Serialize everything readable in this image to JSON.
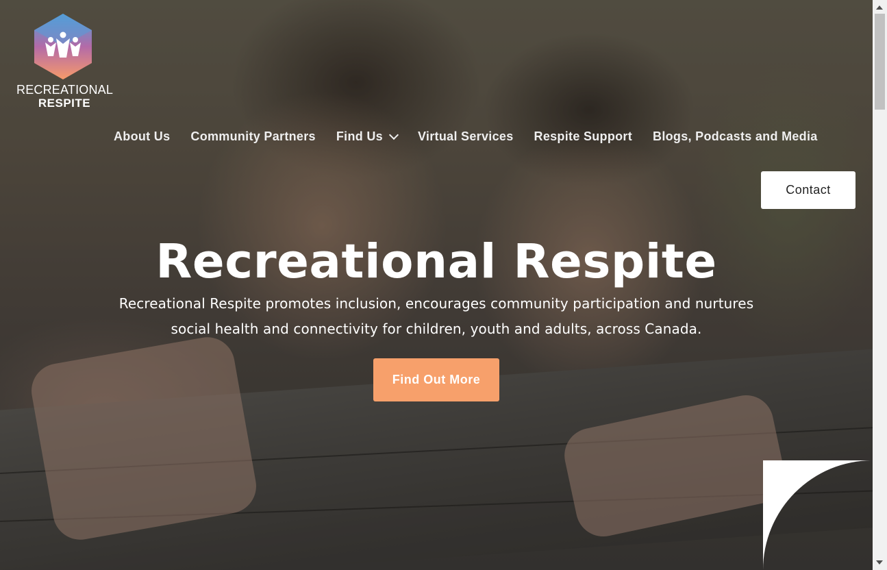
{
  "logo": {
    "line1": "RECREATIONAL",
    "line2": "RESPITE"
  },
  "nav": {
    "items": [
      {
        "label": "About Us"
      },
      {
        "label": "Community Partners"
      },
      {
        "label": "Find Us"
      },
      {
        "label": "Virtual Services"
      },
      {
        "label": "Respite Support"
      },
      {
        "label": "Blogs, Podcasts and Media"
      }
    ],
    "contact_label": "Contact"
  },
  "hero": {
    "title": "Recreational Respite",
    "subtitle": "Recreational Respite promotes inclusion, encourages community participation and nurtures social health and connectivity for children, youth and adults, across Canada.",
    "cta_label": "Find Out More"
  },
  "colors": {
    "accent": "#f7a06b",
    "text_light": "#ffffff"
  },
  "icons": {
    "find_us_dropdown": "chevron-down-icon",
    "logo_mark": "hexagon-people-logo"
  }
}
